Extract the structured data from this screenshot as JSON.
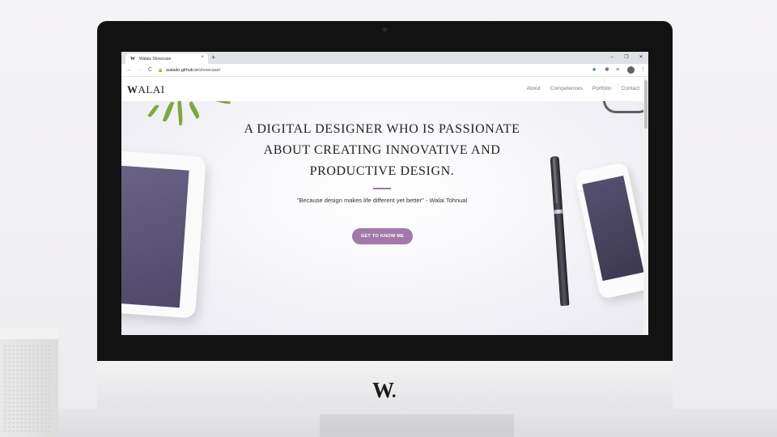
{
  "browser": {
    "tab_title": "Walais Showcase",
    "tab_favicon": "W",
    "tab_close": "×",
    "new_tab": "+",
    "window_controls": [
      "–",
      "❐",
      "✕"
    ],
    "nav": {
      "back": "←",
      "forward": "→",
      "reload": "C"
    },
    "url_host": "walaito.github.io",
    "url_path": "/showcase/",
    "toolbar_icons": [
      "star-icon",
      "puzzle-icon",
      "playlist-icon",
      "profile-icon",
      "menu-icon"
    ]
  },
  "site": {
    "logo_prefix": "W",
    "logo_rest": "ALAI",
    "menu": [
      "About",
      "Competences",
      "Portfolio",
      "Contact"
    ],
    "hero": {
      "title_line1": "A DIGITAL DESIGNER WHO IS PASSIONATE",
      "title_line2": "ABOUT CREATING INNOVATIVE AND",
      "title_line3": "PRODUCTIVE DESIGN.",
      "quote": "\"Because design makes life different yet better\" - Walai Tohnual",
      "cta": "GET TO KNOW ME"
    },
    "accent_color": "#a279aa"
  },
  "device": {
    "chin_logo": "W",
    "chin_logo_dot": "."
  }
}
